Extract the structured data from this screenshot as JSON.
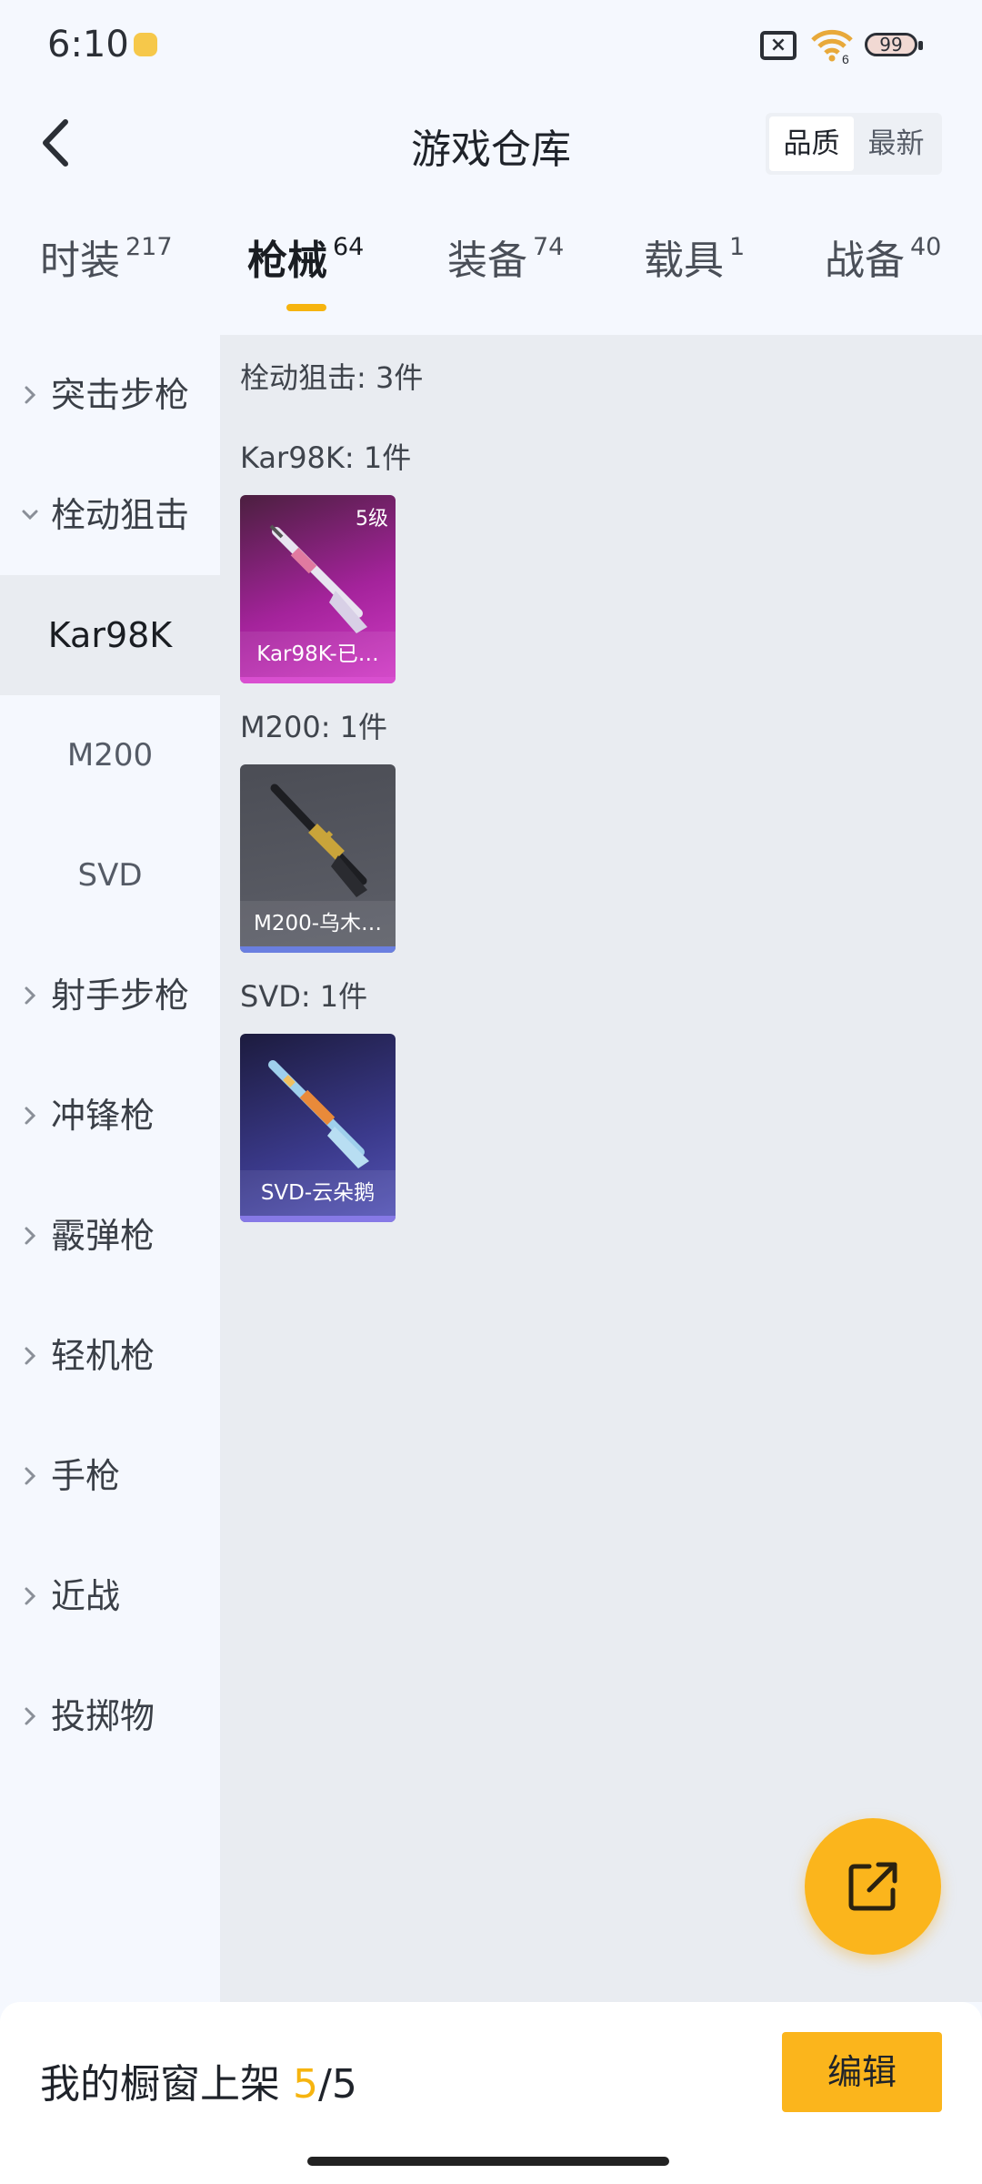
{
  "status_bar": {
    "time": "6:10",
    "sim_icon": "sim-x-icon",
    "wifi_icon": "wifi-icon",
    "wifi_label": "6",
    "battery": "99"
  },
  "header": {
    "title": "游戏仓库",
    "sort_options": [
      "品质",
      "最新"
    ],
    "sort_selected": "品质"
  },
  "tabs": [
    {
      "label": "时装",
      "count": "217"
    },
    {
      "label": "枪械",
      "count": "64",
      "active": true
    },
    {
      "label": "装备",
      "count": "74"
    },
    {
      "label": "载具",
      "count": "1"
    },
    {
      "label": "战备",
      "count": "40"
    }
  ],
  "sidebar": {
    "categories": [
      {
        "label": "突击步枪",
        "expanded": false
      },
      {
        "label": "栓动狙击",
        "expanded": true
      },
      {
        "label": "射手步枪",
        "expanded": false
      },
      {
        "label": "冲锋枪",
        "expanded": false
      },
      {
        "label": "霰弹枪",
        "expanded": false
      },
      {
        "label": "轻机枪",
        "expanded": false
      },
      {
        "label": "手枪",
        "expanded": false
      },
      {
        "label": "近战",
        "expanded": false
      },
      {
        "label": "投掷物",
        "expanded": false
      }
    ],
    "sub_items": [
      {
        "label": "Kar98K",
        "active": true
      },
      {
        "label": "M200"
      },
      {
        "label": "SVD"
      }
    ]
  },
  "content": {
    "category_summary": "栓动狙击: 3件",
    "groups": [
      {
        "heading": "Kar98K: 1件",
        "item_name": "Kar98K-已…",
        "level": "5级",
        "quality_color": "#d23cc7"
      },
      {
        "heading": "M200: 1件",
        "item_name": "M200-乌木…",
        "level": "",
        "quality_color": "#6a7fe0"
      },
      {
        "heading": "SVD: 1件",
        "item_name": "SVD-云朵鹅",
        "level": "",
        "quality_color": "#8679e6"
      }
    ]
  },
  "fab": {
    "icon": "share-external-icon"
  },
  "bottom_bar": {
    "label": "我的橱窗上架",
    "current": "5",
    "total": "/5",
    "edit_label": "编辑"
  },
  "colors": {
    "accent": "#fbb51c",
    "background": "#f5f8fe",
    "content_bg": "#e9ecf1"
  }
}
